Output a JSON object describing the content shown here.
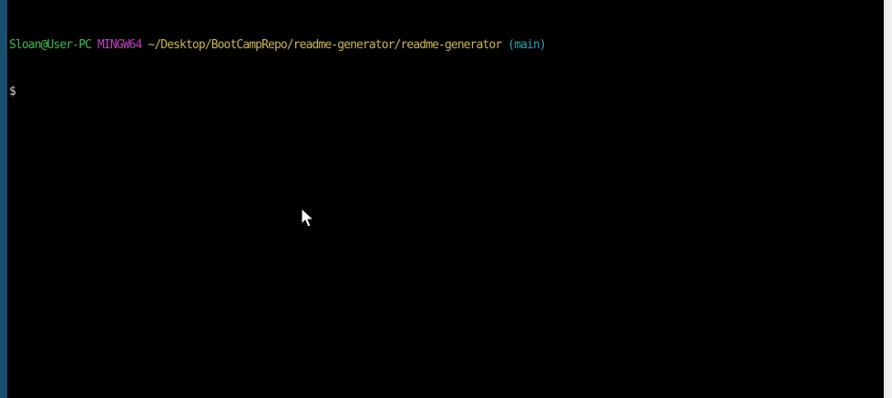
{
  "terminal": {
    "prompt": {
      "user_host": "Sloan@User-PC",
      "env": "MINGW64",
      "path": "~/Desktop/BootCampRepo/readme-generator/readme-generator",
      "branch": "(main)"
    },
    "command_prompt": "$"
  },
  "colors": {
    "background": "#000000",
    "user_host": "#3fb950",
    "env": "#c040c0",
    "path": "#c9b458",
    "branch": "#2aa1b3",
    "text": "#d7d7d7"
  },
  "icons": {
    "mouse_cursor": "mouse-pointer-icon"
  }
}
